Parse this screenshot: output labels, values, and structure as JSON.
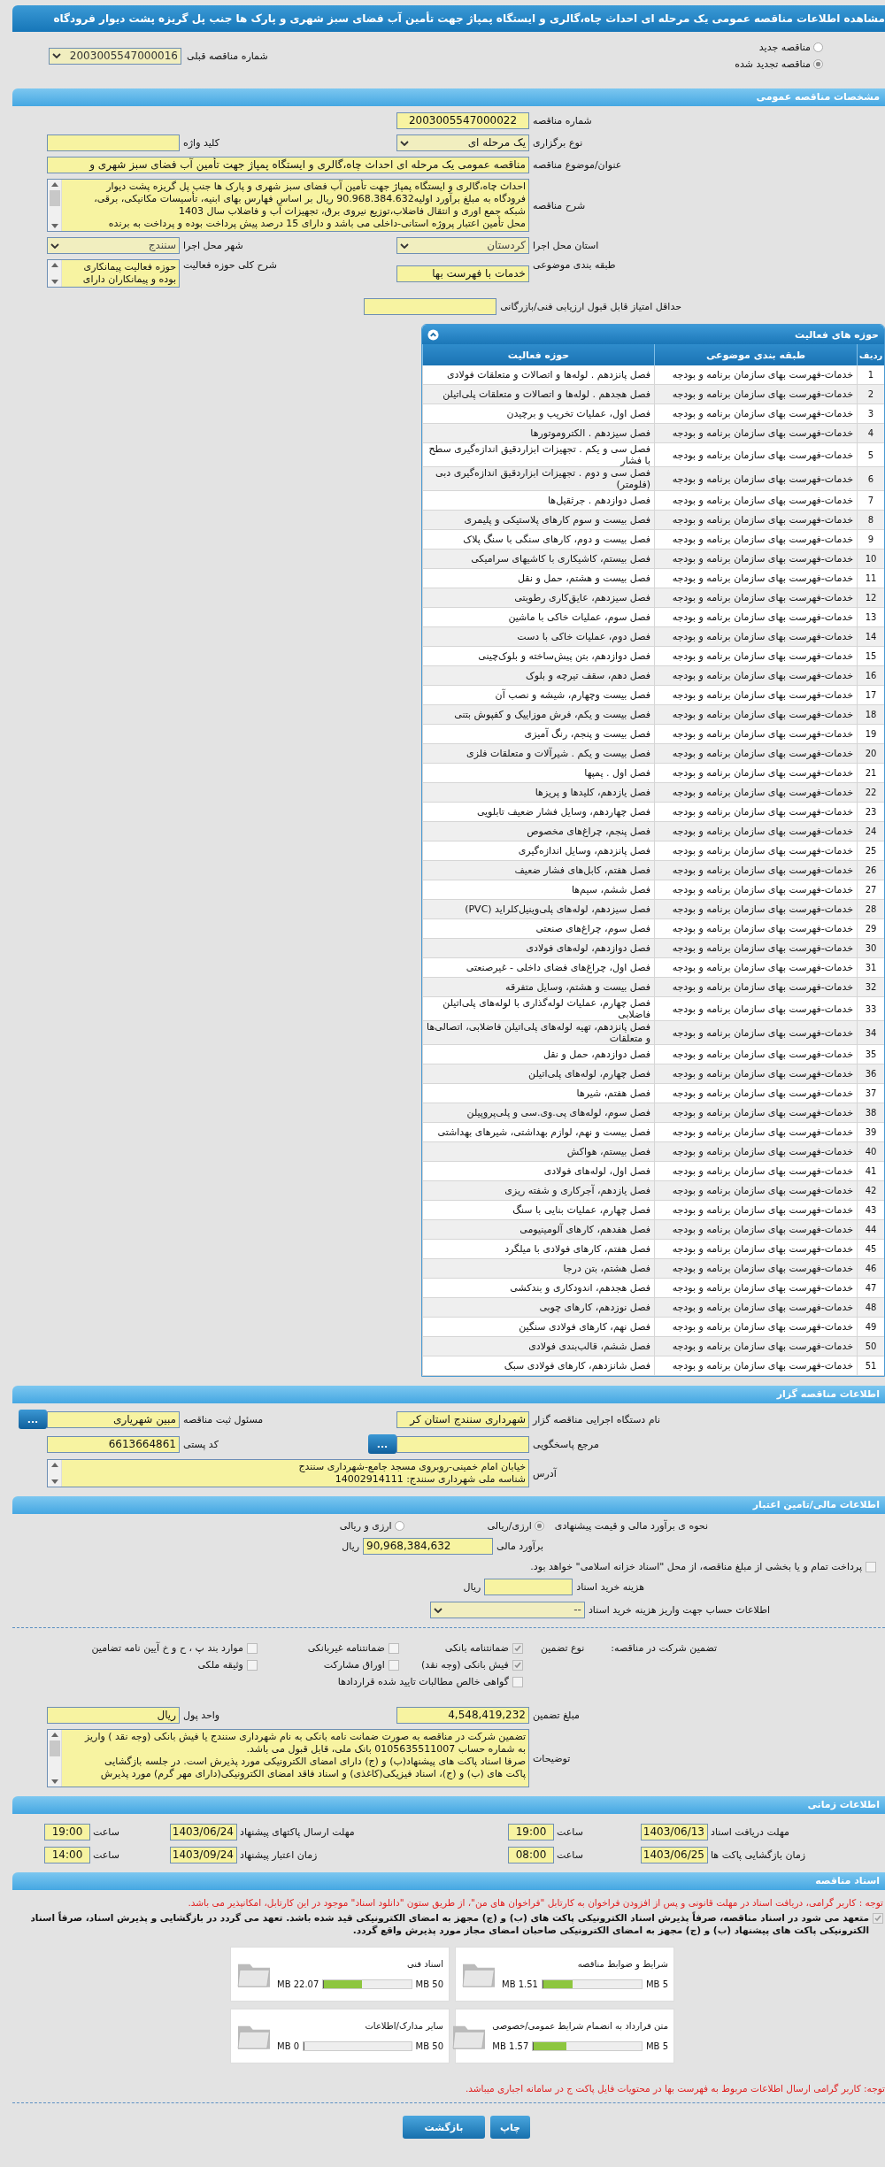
{
  "page_title": "مشاهده اطلاعات مناقصه عمومی یک مرحله ای احداث چاه،گالری و ایستگاه پمپاژ جهت تأمین آب فضای سبز شهری و پارک ها جنب پل گریزه پشت دیوار فرودگاه",
  "tender_modes": [
    {
      "label": "مناقصه جدید",
      "selected": false
    },
    {
      "label": "مناقصه تجدید شده",
      "selected": true
    }
  ],
  "previous_tender": {
    "label": "شماره مناقصه قبلی",
    "value": "2003005547000016"
  },
  "general": {
    "title": "مشخصات مناقصه عمومی",
    "tender_number": {
      "label": "شماره مناقصه",
      "value": "2003005547000022"
    },
    "holding_type": {
      "label": "نوع برگزاری",
      "value": "یک مرحله ای"
    },
    "keyword": {
      "label": "کلید واژه"
    },
    "subject": {
      "label": "عنوان/موضوع مناقصه",
      "value": "مناقصه عمومی یک مرحله ای احداث چاه،گالری و ایستگاه پمپاژ جهت تأمین آب فضای سبز شهری و"
    },
    "description": {
      "label": "شرح مناقصه",
      "lines": [
        "احداث چاه،گالری و ایستگاه پمپاژ جهت تأمین آب فضای سبز شهری و پارک ها جنب پل گریزه پشت دیوار",
        "فرودگاه به مبلغ برآورد اولیه90.968.384.632 ریال بر اساس فهارس بهای ابنیه، تأسیسات مکانیکی، برقی،",
        "شبکه جمع اوری و انتقال فاضلاب،توزیع نیروی برق، تجهیزات آب و فاضلاب سال  1403",
        "محل تأمین اعتبار پروژه استانی-داخلی می باشد و دارای 15 درصد پیش پرداخت بوده و پرداخت به برنده"
      ]
    },
    "province": {
      "label": "استان محل اجرا",
      "value": "کردستان"
    },
    "city": {
      "label": "شهر محل اجرا",
      "value": "سنندج"
    },
    "category": {
      "label": "طبقه بندی موضوعی",
      "value": "خدمات با فهرست بها"
    },
    "scope": {
      "label": "شرح کلی حوزه فعالیت",
      "lines": [
        "حوزه فعالیت پیمانکاری",
        "بوده و پیمانکاران دارای"
      ]
    },
    "min_score": {
      "label": "حداقل امتیاز قابل قبول ارزیابی فنی/بازرگانی"
    }
  },
  "activities": {
    "title": "حوزه های فعالیت",
    "columns": [
      "ردیف",
      "طبقه بندی موضوعی",
      "حوزه فعالیت"
    ],
    "rows": [
      {
        "number": "1",
        "category": "خدمات-فهرست بهای سازمان برنامه و بودجه",
        "activity": "فصل پانزدهم . لوله‌ها و اتصالات و متعلقات فولادی"
      },
      {
        "number": "2",
        "category": "خدمات-فهرست بهای سازمان برنامه و بودجه",
        "activity": "فصل هجدهم . لوله‌ها و اتصالات و متعلقات  پلی‌اتیلن"
      },
      {
        "number": "3",
        "category": "خدمات-فهرست بهای سازمان برنامه و بودجه",
        "activity": "فصل اول، عملیات تخریب و برچیدن"
      },
      {
        "number": "4",
        "category": "خدمات-فهرست بهای سازمان برنامه و بودجه",
        "activity": "فصل سیزدهم . الکتروموتورها"
      },
      {
        "number": "5",
        "category": "خدمات-فهرست بهای سازمان برنامه و بودجه",
        "activity": "فصل سی و یکم . تجهیزات ابزاردقیق اندازه‌گیری سطح با فشار"
      },
      {
        "number": "6",
        "category": "خدمات-فهرست بهای سازمان برنامه و بودجه",
        "activity": "فصل سی و دوم . تجهیزات ابزاردقیق اندازه‌گیری دبی (فلومتر)"
      },
      {
        "number": "7",
        "category": "خدمات-فهرست بهای سازمان برنامه و بودجه",
        "activity": "فصل دوازدهم . جرثقیل‌ها"
      },
      {
        "number": "8",
        "category": "خدمات-فهرست بهای سازمان برنامه و بودجه",
        "activity": "فصل بیست و سوم کارهای پلاستیکی و پلیمری"
      },
      {
        "number": "9",
        "category": "خدمات-فهرست بهای سازمان برنامه و بودجه",
        "activity": "فصل بیست و دوم، کارهای سنگی با سنگ پلاک"
      },
      {
        "number": "10",
        "category": "خدمات-فهرست بهای سازمان برنامه و بودجه",
        "activity": "فصل بیستم، کاشیکاری با کاشیهای سرامیکی"
      },
      {
        "number": "11",
        "category": "خدمات-فهرست بهای سازمان برنامه و بودجه",
        "activity": "فصل بیست و هشتم، حمل و نقل"
      },
      {
        "number": "12",
        "category": "خدمات-فهرست بهای سازمان برنامه و بودجه",
        "activity": "فصل سیزدهم، عایق‌کاری رطوبتی"
      },
      {
        "number": "13",
        "category": "خدمات-فهرست بهای سازمان برنامه و بودجه",
        "activity": "فصل سوم، عملیات خاکی با ماشین"
      },
      {
        "number": "14",
        "category": "خدمات-فهرست بهای سازمان برنامه و بودجه",
        "activity": "فصل دوم، عملیات خاکی با دست"
      },
      {
        "number": "15",
        "category": "خدمات-فهرست بهای سازمان برنامه و بودجه",
        "activity": "فصل دوازدهم، بتن پیش‌ساخته و بلوک‌چینی"
      },
      {
        "number": "16",
        "category": "خدمات-فهرست بهای سازمان برنامه و بودجه",
        "activity": "فصل دهم، سقف تیرچه و بلوک"
      },
      {
        "number": "17",
        "category": "خدمات-فهرست بهای سازمان برنامه و بودجه",
        "activity": "فصل بیست وچهارم، شیشه و نصب آن"
      },
      {
        "number": "18",
        "category": "خدمات-فهرست بهای سازمان برنامه و بودجه",
        "activity": "فصل بیست و یکم، فرش موزاییک و کفپوش بتنی"
      },
      {
        "number": "19",
        "category": "خدمات-فهرست بهای سازمان برنامه و بودجه",
        "activity": "فصل بیست و پنجم، رنگ آمیزی"
      },
      {
        "number": "20",
        "category": "خدمات-فهرست بهای سازمان برنامه و بودجه",
        "activity": "فصل بیست و یکم . شیرآلات و متعلقات فلزی"
      },
      {
        "number": "21",
        "category": "خدمات-فهرست بهای سازمان برنامه و بودجه",
        "activity": "فصل اول . پمپها"
      },
      {
        "number": "22",
        "category": "خدمات-فهرست بهای سازمان برنامه و بودجه",
        "activity": "فصل یازدهم، کلیدها و پریزها"
      },
      {
        "number": "23",
        "category": "خدمات-فهرست بهای سازمان برنامه و بودجه",
        "activity": "فصل چهاردهم، وسایل فشار ضعیف تابلویی"
      },
      {
        "number": "24",
        "category": "خدمات-فهرست بهای سازمان برنامه و بودجه",
        "activity": "فصل پنجم، چراغ‌های مخصوص"
      },
      {
        "number": "25",
        "category": "خدمات-فهرست بهای سازمان برنامه و بودجه",
        "activity": "فصل پانزدهم، وسایل اندازه‌گیری"
      },
      {
        "number": "26",
        "category": "خدمات-فهرست بهای سازمان برنامه و بودجه",
        "activity": "فصل هفتم، کابل‌های فشار ضعیف"
      },
      {
        "number": "27",
        "category": "خدمات-فهرست بهای سازمان برنامه و بودجه",
        "activity": "فصل ششم، سیم‌ها"
      },
      {
        "number": "28",
        "category": "خدمات-فهرست بهای سازمان برنامه و بودجه",
        "activity": "فصل سیزدهم، لوله‌های پلی‌وینیل‌کلراید (PVC)"
      },
      {
        "number": "29",
        "category": "خدمات-فهرست بهای سازمان برنامه و بودجه",
        "activity": "فصل سوم، چراغ‌های صنعتی"
      },
      {
        "number": "30",
        "category": "خدمات-فهرست بهای سازمان برنامه و بودجه",
        "activity": "فصل دوازدهم، لوله‌های فولادی"
      },
      {
        "number": "31",
        "category": "خدمات-فهرست بهای سازمان برنامه و بودجه",
        "activity": "فصل اول، چراغ‌های فضای داخلی - غیرصنعتی"
      },
      {
        "number": "32",
        "category": "خدمات-فهرست بهای سازمان برنامه و بودجه",
        "activity": "فصل بیست و هشتم، وسایل متفرقه"
      },
      {
        "number": "33",
        "category": "خدمات-فهرست بهای سازمان برنامه و بودجه",
        "activity": "فصل چهارم، عملیات لوله‌گذاری با لوله‌های پلی‌اتیلن فاضلابی"
      },
      {
        "number": "34",
        "category": "خدمات-فهرست بهای سازمان برنامه و بودجه",
        "activity": "فصل پانزدهم، تهیه لوله‌های پلی‌اتیلن فاضلابی، اتصالی‌ها و متعلقات"
      },
      {
        "number": "35",
        "category": "خدمات-فهرست بهای سازمان برنامه و بودجه",
        "activity": "فصل دوازدهم، حمل و نقل"
      },
      {
        "number": "36",
        "category": "خدمات-فهرست بهای سازمان برنامه و بودجه",
        "activity": "فصل چهارم، لوله‌های پلی‌اتیلن"
      },
      {
        "number": "37",
        "category": "خدمات-فهرست بهای سازمان برنامه و بودجه",
        "activity": "فصل هفتم، شیرها"
      },
      {
        "number": "38",
        "category": "خدمات-فهرست بهای سازمان برنامه و بودجه",
        "activity": "فصل سوم، لوله‌های پی.وی.سی و پلی‌پروپیلن"
      },
      {
        "number": "39",
        "category": "خدمات-فهرست بهای سازمان برنامه و بودجه",
        "activity": "فصل بیست و نهم، لوازم بهداشتی، شیرهای بهداشتی"
      },
      {
        "number": "40",
        "category": "خدمات-فهرست بهای سازمان برنامه و بودجه",
        "activity": "فصل بیستم، هواکش"
      },
      {
        "number": "41",
        "category": "خدمات-فهرست بهای سازمان برنامه و بودجه",
        "activity": "فصل اول، لوله‌های فولادی"
      },
      {
        "number": "42",
        "category": "خدمات-فهرست بهای سازمان برنامه و بودجه",
        "activity": "فصل یازدهم، آجرکاری و شفته ریزی"
      },
      {
        "number": "43",
        "category": "خدمات-فهرست بهای سازمان برنامه و بودجه",
        "activity": "فصل چهارم، عملیات بنایی با سنگ"
      },
      {
        "number": "44",
        "category": "خدمات-فهرست بهای سازمان برنامه و بودجه",
        "activity": "فصل هفدهم، کارهای آلومینیومی"
      },
      {
        "number": "45",
        "category": "خدمات-فهرست بهای سازمان برنامه و بودجه",
        "activity": "فصل هفتم، کارهای فولادی با میلگرد"
      },
      {
        "number": "46",
        "category": "خدمات-فهرست بهای سازمان برنامه و بودجه",
        "activity": "فصل هشتم، بتن درجا"
      },
      {
        "number": "47",
        "category": "خدمات-فهرست بهای سازمان برنامه و بودجه",
        "activity": "فصل هجدهم، اندودکاری و بندکشی"
      },
      {
        "number": "48",
        "category": "خدمات-فهرست بهای سازمان برنامه و بودجه",
        "activity": "فصل نوزدهم، کارهای چوبی"
      },
      {
        "number": "49",
        "category": "خدمات-فهرست بهای سازمان برنامه و بودجه",
        "activity": "فصل نهم، کارهای فولادی سنگین"
      },
      {
        "number": "50",
        "category": "خدمات-فهرست بهای سازمان برنامه و بودجه",
        "activity": "فصل ششم، قالب‌بندی فولادی"
      },
      {
        "number": "51",
        "category": "خدمات-فهرست بهای سازمان برنامه و بودجه",
        "activity": "فصل شانزدهم، کارهای فولادی سبک"
      }
    ]
  },
  "organizer": {
    "title": "اطلاعات مناقصه گزار",
    "agency": {
      "label": "نام دستگاه اجرایی مناقصه گزار",
      "value": "شهرداری سنندج استان کر"
    },
    "registrar": {
      "label": "مسئول ثبت مناقصه",
      "value": "مبین شهریاری",
      "button": "..."
    },
    "responder": {
      "label": "مرجع پاسخگویی",
      "button": "..."
    },
    "postal_code": {
      "label": "کد پستی",
      "value": "6613664861"
    },
    "address": {
      "label": "آدرس",
      "lines": [
        "خیابان امام خمینی-روبروی مسجد جامع-شهرداری سنندج",
        "شناسه ملی شهرداری سنندج: 14002914111"
      ]
    }
  },
  "financial": {
    "title": "اطلاعات مالی/تامین اعتبار",
    "estimate_method": {
      "label": "نحوه ی برآورد مالی و قیمت پیشنهادی",
      "options": [
        {
          "label": "ارزی/ریالی",
          "selected": true
        },
        {
          "label": "ارزی و ریالی",
          "selected": false
        }
      ]
    },
    "estimate": {
      "label": "برآورد مالی",
      "value": "90,968,384,632",
      "unit": "ریال"
    },
    "treasury": {
      "label": "پرداخت تمام و یا بخشی از مبلغ مناقصه، از محل \"اسناد خزانه اسلامی\" خواهد بود.",
      "checked": false
    },
    "document_fee": {
      "label": "هزینه خرید اسناد",
      "unit": "ریال"
    },
    "fee_account": {
      "label": "اطلاعات حساب جهت واریز هزینه خرید اسناد",
      "value": "--"
    }
  },
  "guarantee": {
    "label": "تضمین شرکت در مناقصه:",
    "type_label": "نوع تضمین",
    "options": [
      {
        "label": "ضمانتنامه بانکی",
        "checked": true
      },
      {
        "label": "ضمانتنامه غیربانکی",
        "checked": false
      },
      {
        "label": "موارد بند پ ، ح و خ آیین نامه تضامین",
        "checked": false
      },
      {
        "label": "فیش بانکی (وجه نقد)",
        "checked": true
      },
      {
        "label": "اوراق مشارکت",
        "checked": false
      },
      {
        "label": "وثیقه ملکی",
        "checked": false
      },
      {
        "label": "گواهی خالص مطالبات تایید شده قراردادها",
        "checked": false
      }
    ],
    "amount": {
      "label": "مبلغ تضمین",
      "value": "4,548,419,232"
    },
    "currency": {
      "label": "واحد پول",
      "value": "ریال"
    },
    "notes": {
      "label": "توضیحات",
      "lines": [
        "تضمین شرکت در مناقصه به صورت ضمانت نامه بانکی به نام شهرداری سنندج یا فیش بانکی (وجه نقد ) واریز",
        "به شماره حساب 0105635511007 بانک ملی، قابل قبول می باشد.",
        "صرفا اسناد پاکت های پیشنهاد(ب) و (ج) دارای امضای الکترونیکی مورد پذیرش است. در جلسه بازگشایی",
        "پاکت های (ب) و (ج)، اسناد فیزیکی(کاغذی) و اسناد فاقد امضای الکترونیکی(دارای مهر گرم) مورد پذیرش"
      ]
    }
  },
  "schedule": {
    "title": "اطلاعات زمانی",
    "items": [
      {
        "label": "مهلت دریافت اسناد",
        "date": "1403/06/13",
        "time_label": "ساعت",
        "time": "19:00"
      },
      {
        "label": "مهلت ارسال پاکتهای پیشنهاد",
        "date": "1403/06/24",
        "time_label": "ساعت",
        "time": "19:00"
      },
      {
        "label": "زمان بازگشایی پاکت ها",
        "date": "1403/06/25",
        "time_label": "ساعت",
        "time": "08:00"
      },
      {
        "label": "زمان اعتبار پیشنهاد",
        "date": "1403/09/24",
        "time_label": "ساعت",
        "time": "14:00"
      }
    ]
  },
  "documents": {
    "title": "اسناد مناقصه",
    "notice": "توجه : کاربر گرامی، دریافت اسناد در مهلت قانونی و پس از افزودن فراخوان به کارتابل \"فراخوان های من\"، از طریق ستون \"دانلود اسناد\" موجود در این کارتابل، امکانپذیر می باشد.",
    "commitment": {
      "checked": true,
      "text": "متعهد می شود در اسناد مناقصه، صرفاً پذیرش اسناد الکترونیکی پاکت های (ب) و (ج) مجهز به امضای الکترونیکی قید شده باشد. تعهد می گردد در بازگشایی و پذیرش اسناد، صرفاً اسناد الکترونیکی پاکت های پیشنهاد (ب) و (ج) مجهز به امضای الکترونیکی صاحبان امضای مجاز مورد پذیرش واقع گردد."
    },
    "files": [
      {
        "name": "شرایط و ضوابط مناقصه",
        "size": "1.51 MB",
        "max": "5 MB",
        "level": 0.3
      },
      {
        "name": "اسناد فنی",
        "size": "22.07 MB",
        "max": "50 MB",
        "level": 0.44
      },
      {
        "name": "متن قرارداد به انضمام شرایط عمومی/خصوصی",
        "size": "1.57 MB",
        "max": "5 MB",
        "level": 0.31
      },
      {
        "name": "سایر مدارک/اطلاعات",
        "size": "0 MB",
        "max": "50 MB",
        "level": 0
      }
    ]
  },
  "footer_note": "توجه: کاربر گرامی ارسال اطلاعات مربوط به فهرست بها در محتویات فایل پاکت ج در سامانه اجباری میباشد.",
  "buttons": [
    "چاپ",
    "بازگشت"
  ]
}
